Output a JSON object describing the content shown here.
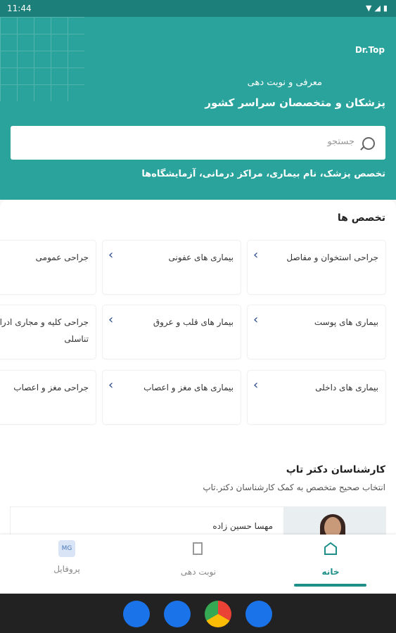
{
  "status": {
    "time": "11:44",
    "icons": "▼◢▮"
  },
  "header": {
    "logo": "Dr.Top",
    "line1": "معرفی و نوبت دهی",
    "line2": "پزشکان و متخصصان سراسر کشور",
    "search_placeholder": "جستجو",
    "hint": "تخصص پزشک، نام بیماری، مراکز درمانی، آزمایشگاه‌ها"
  },
  "specialties": {
    "title": "تخصص ها",
    "items": [
      {
        "label": "جراحی استخوان و مفاصل"
      },
      {
        "label": "بیماری های عفونی"
      },
      {
        "label": "جراحی عمومی"
      },
      {
        "label": "بیماری های پوست"
      },
      {
        "label": "بیمار های قلب و عروق"
      },
      {
        "label": "جراحی کلیه و مجاری ادرار تناسلی"
      },
      {
        "label": "بیماری های داخلی"
      },
      {
        "label": "بیماری های مغز و اعصاب"
      },
      {
        "label": "جراحی مغز و اعصاب"
      }
    ]
  },
  "experts": {
    "title": "کارشناسان دکتر تاپ",
    "subtitle": "انتخاب صحیح متخصص به کمک کارشناسان دکتر.تاپ",
    "name": "مهسا حسین زاده"
  },
  "tabs": [
    {
      "label": "خانه",
      "icon": "home-icon"
    },
    {
      "label": "نوبت دهی",
      "icon": "calendar-icon"
    },
    {
      "label": "پروفایل",
      "icon": "profile-icon",
      "badge": "MG"
    }
  ]
}
